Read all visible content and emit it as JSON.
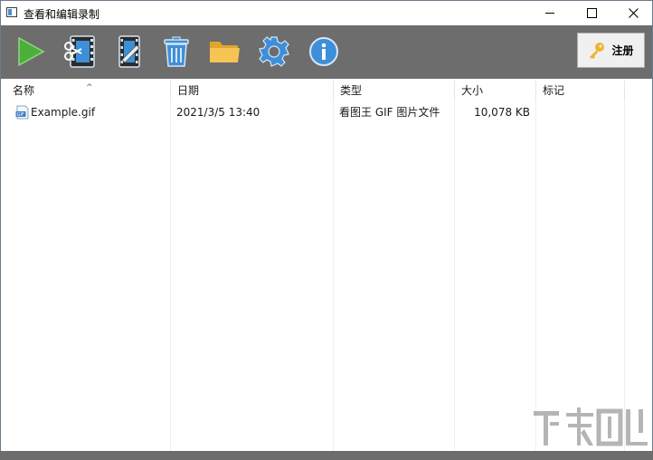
{
  "window": {
    "title": "查看和编辑录制",
    "controls": {
      "minimize": "minimize-icon",
      "maximize": "maximize-icon",
      "close": "close-icon"
    }
  },
  "toolbar": {
    "buttons": [
      {
        "name": "play",
        "icon": "play-icon",
        "color": "#4caf3a"
      },
      {
        "name": "edit-video",
        "icon": "film-scissors-icon",
        "color": "#3d8fd9"
      },
      {
        "name": "edit-frames",
        "icon": "film-pencil-icon",
        "color": "#3d8fd9"
      },
      {
        "name": "delete",
        "icon": "trash-icon",
        "color": "#3d8fd9"
      },
      {
        "name": "open-folder",
        "icon": "folder-icon",
        "color": "#f2b233"
      },
      {
        "name": "settings",
        "icon": "gear-icon",
        "color": "#3d8fd9"
      },
      {
        "name": "info",
        "icon": "info-icon",
        "color": "#3d8fd9"
      }
    ],
    "register_label": "注册",
    "register_icon": "key-icon"
  },
  "list": {
    "columns": [
      "名称",
      "日期",
      "类型",
      "大小",
      "标记"
    ],
    "sort_column": "名称",
    "rows": [
      {
        "name": "Example.gif",
        "date": "2021/3/5 13:40",
        "type": "看图王 GIF 图片文件",
        "size": "10,078 KB",
        "mark": ""
      }
    ]
  },
  "colors": {
    "toolbar_bg": "#6d6d6d",
    "accent_blue": "#3d8fd9"
  }
}
